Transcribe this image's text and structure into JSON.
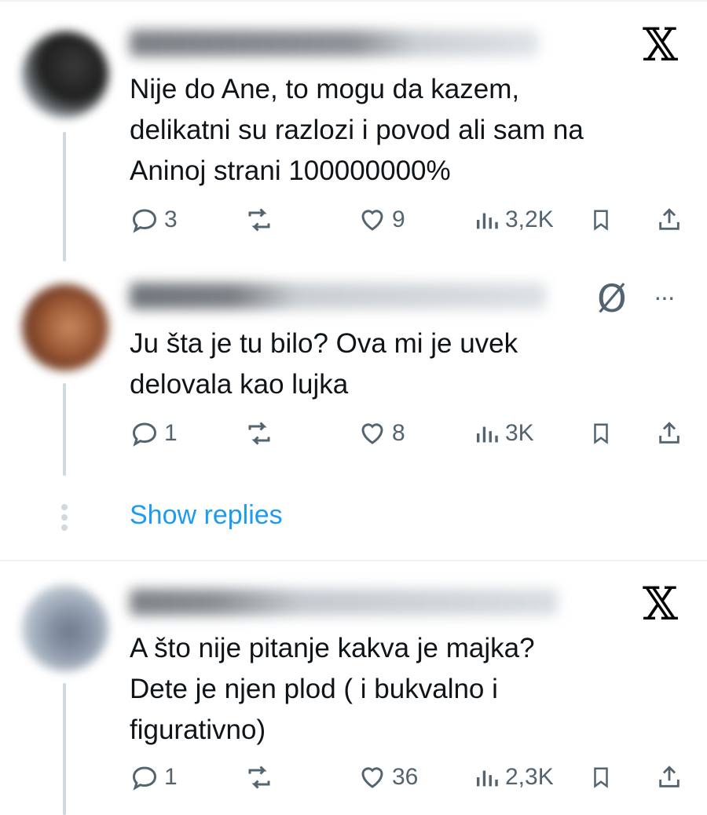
{
  "tweets": [
    {
      "text_lines": [
        "Nije do Ane, to mogu da kazem,",
        "delikatni su razlozi i povod ali sam na",
        "Aninoj strani 100000000%"
      ],
      "replies": "3",
      "retweets": "",
      "likes": "9",
      "views": "3,2K",
      "badge_icon": "x-logo-icon",
      "badge_glyph": "𝕏"
    },
    {
      "text_lines": [
        "Ju šta je tu bilo? Ova mi je uvek",
        "delovala kao lujka"
      ],
      "replies": "1",
      "retweets": "",
      "likes": "8",
      "views": "3K",
      "badge_icon": "grok-icon",
      "badge_glyph": "Ø",
      "more_glyph": "···"
    },
    {
      "text_lines": [
        "A što nije pitanje kakva je majka?",
        "Dete je njen plod ( i bukvalno i",
        "figurativno)"
      ],
      "replies": "1",
      "retweets": "",
      "likes": "36",
      "views": "2,3K",
      "badge_icon": "x-logo-icon",
      "badge_glyph": "𝕏"
    }
  ],
  "show_replies_label": "Show replies",
  "colors": {
    "accent": "#1d9bf0",
    "muted": "#536471",
    "thread": "#cfd9de"
  }
}
